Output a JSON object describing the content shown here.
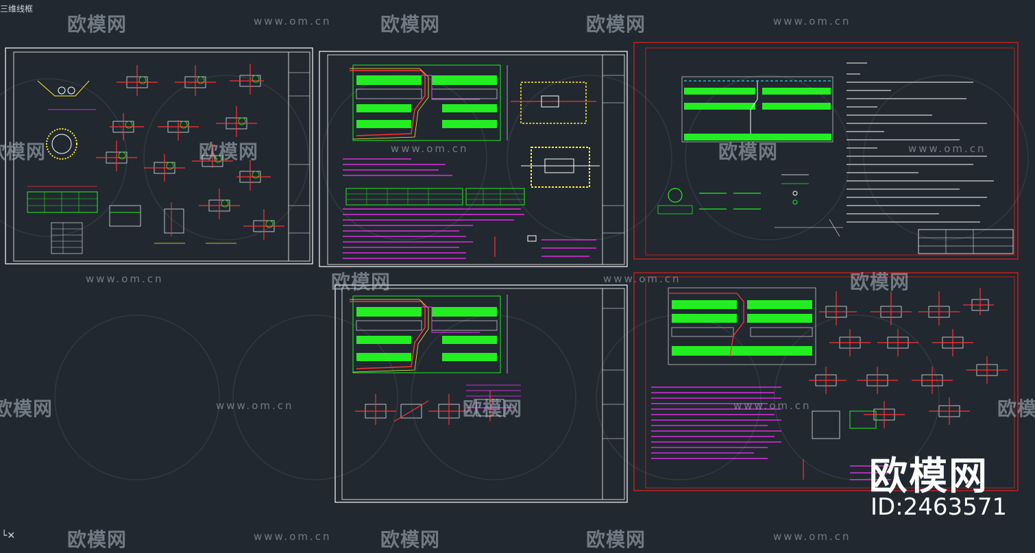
{
  "view": {
    "label": "三维线框",
    "label_visible": "三维线框"
  },
  "watermark": {
    "logo_text": "欧模网",
    "url_text": "www.om.cn",
    "big_text": "欧模网",
    "id_text": "ID:2463571"
  },
  "colors": {
    "background": "#212830",
    "frame": "#ffffff",
    "frame_red": "#e02020",
    "green": "#22ee22",
    "magenta": "#ff33ff",
    "yellow": "#ffee33",
    "cyan": "#33ffff",
    "red": "#ff3333"
  },
  "icons": {
    "ucs": "ucs-axis-icon"
  }
}
